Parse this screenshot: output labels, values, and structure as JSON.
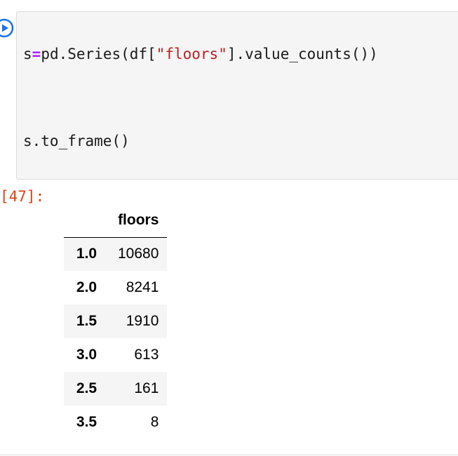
{
  "code_cell": {
    "line1": {
      "var": "s",
      "op": "=",
      "call_start": "pd.Series(df[",
      "string": "\"floors\"",
      "call_end": "].value_counts())"
    },
    "line2": "s.to_frame()"
  },
  "output": {
    "prompt": "[47]:",
    "column_header": "floors",
    "rows": [
      {
        "index": "1.0",
        "value": "10680"
      },
      {
        "index": "2.0",
        "value": "8241"
      },
      {
        "index": "1.5",
        "value": "1910"
      },
      {
        "index": "3.0",
        "value": "613"
      },
      {
        "index": "2.5",
        "value": "161"
      },
      {
        "index": "3.5",
        "value": "8"
      }
    ]
  },
  "icons": {
    "run": "play-circle-icon"
  },
  "colors": {
    "run_icon": "#1a73e8",
    "prompt": "#d84315",
    "keyword_op": "#aa22ff",
    "string": "#ba2121",
    "cell_bg": "#f5f5f5"
  }
}
